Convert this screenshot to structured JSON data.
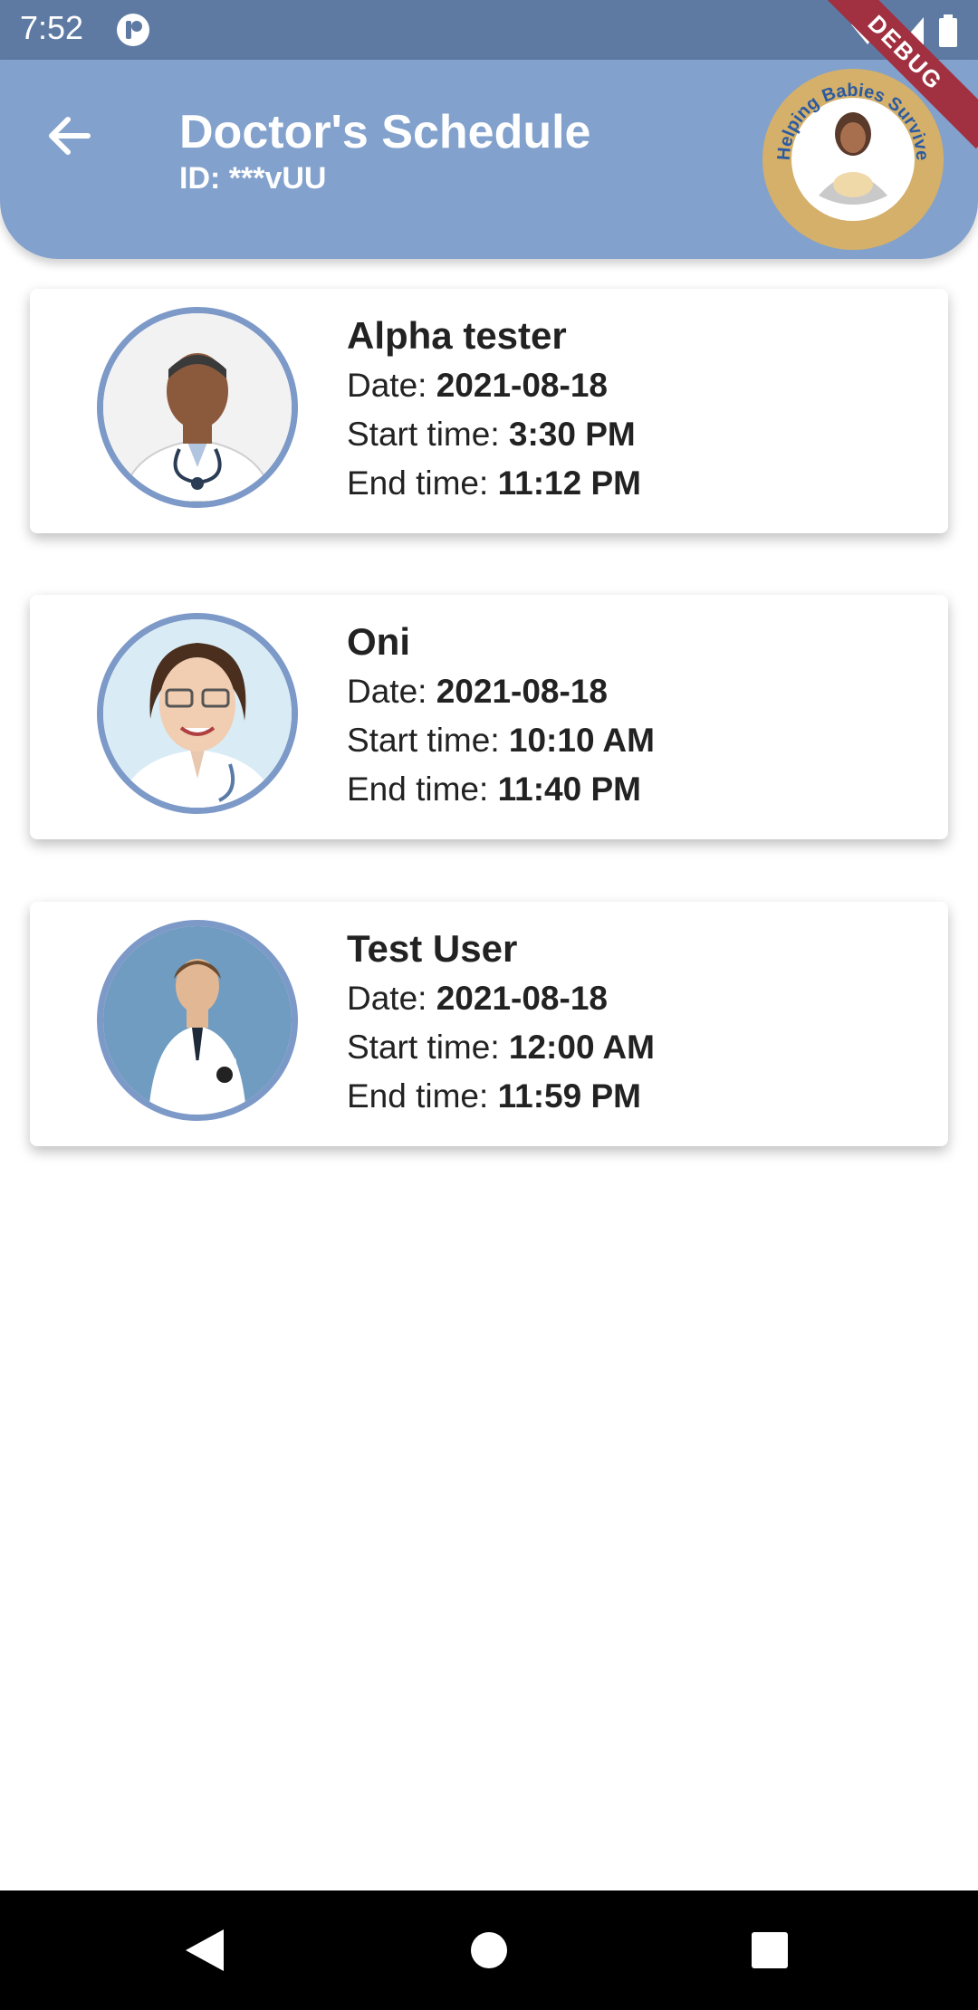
{
  "status": {
    "time": "7:52"
  },
  "appbar": {
    "title": "Doctor's Schedule",
    "subtitle": "ID: ***vUU",
    "logo_text": "Helping Babies Survive",
    "debug_label": "DEBUG"
  },
  "labels": {
    "date": "Date:",
    "start": "Start time:",
    "end": "End time:"
  },
  "doctors": [
    {
      "name": "Alpha tester",
      "date": "2021-08-18",
      "start": "3:30 PM",
      "end": "11:12 PM"
    },
    {
      "name": "Oni",
      "date": "2021-08-18",
      "start": "10:10 AM",
      "end": "11:40 PM"
    },
    {
      "name": "Test User",
      "date": "2021-08-18",
      "start": "12:00 AM",
      "end": "11:59 PM"
    }
  ],
  "colors": {
    "statusbar": "#5e7aa3",
    "appbar": "#82a1cc",
    "avatar_ring": "#7c99c8",
    "logo_ring": "#d4b06a"
  }
}
